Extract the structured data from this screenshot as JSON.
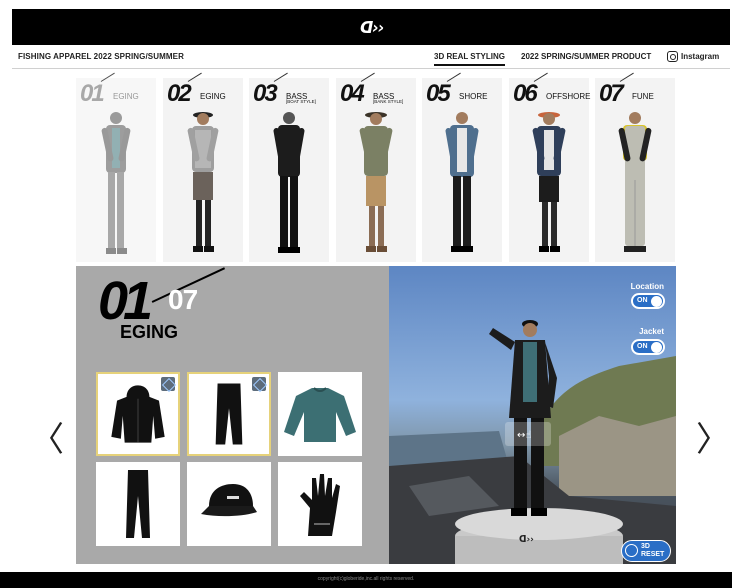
{
  "header": {
    "logo": "ᗡ››"
  },
  "nav": {
    "brand": "FISHING APPAREL 2022 SPRING/SUMMER",
    "links": [
      "3D REAL STYLING",
      "2022 SPRING/SUMMER PRODUCT",
      "Instagram"
    ],
    "active": "3D REAL STYLING"
  },
  "styles": [
    {
      "num": "01",
      "name": "EGING",
      "sub": ""
    },
    {
      "num": "02",
      "name": "EGING",
      "sub": ""
    },
    {
      "num": "03",
      "name": "BASS",
      "sub": "[BOAT STYLE]"
    },
    {
      "num": "04",
      "name": "BASS",
      "sub": "[BANK STYLE]"
    },
    {
      "num": "05",
      "name": "SHORE",
      "sub": ""
    },
    {
      "num": "06",
      "name": "OFFSHORE",
      "sub": ""
    },
    {
      "num": "07",
      "name": "FUNE",
      "sub": ""
    }
  ],
  "detail": {
    "current": "01",
    "total": "07",
    "title": "EGING",
    "items": [
      "jacket",
      "pants",
      "long-sleeve-shirt",
      "under-pants",
      "cap",
      "glove"
    ]
  },
  "viewer": {
    "location_label": "Location",
    "location_state": "ON",
    "jacket_label": "Jacket",
    "jacket_state": "ON",
    "reset_label_1": "3D",
    "reset_label_2": "RESET"
  },
  "arrows": {
    "prev": "〈",
    "next": "〉"
  },
  "footer": {
    "copyright": "copyright(c)globeride,inc.all rights reserved."
  },
  "colors": {
    "toggle": "#2a6ec6",
    "selected_border": "#e6d27a",
    "panel_bg": "#a9a9a9"
  }
}
